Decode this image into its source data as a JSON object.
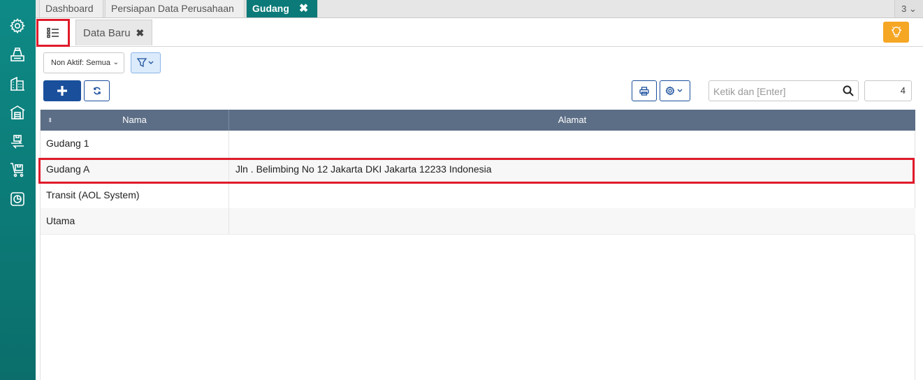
{
  "tabs": [
    {
      "label": "Dashboard"
    },
    {
      "label": "Persiapan Data Perusahaan"
    },
    {
      "label": "Gudang",
      "close": "✖"
    }
  ],
  "tab_count": "3 ⌄",
  "subtab": {
    "label": "Data Baru",
    "close": "✖"
  },
  "filter": {
    "value": "Non Aktif: Semua",
    "chevron": "⌄"
  },
  "search": {
    "placeholder": "Ketik dan [Enter]"
  },
  "record_count": "4",
  "table": {
    "columns": [
      "Nama",
      "Alamat"
    ],
    "rows": [
      {
        "nama": "Gudang 1",
        "alamat": ""
      },
      {
        "nama": "Gudang A",
        "alamat": "Jln . Belimbing No 12 Jakarta DKI Jakarta 12233 Indonesia"
      },
      {
        "nama": "Transit (AOL System)",
        "alamat": ""
      },
      {
        "nama": "Utama",
        "alamat": ""
      }
    ]
  },
  "sort_glyph": "⬍",
  "colors": {
    "sidebar": "#0b7a78",
    "header": "#5c6e86",
    "primary": "#1a4f9c",
    "highlight": "#e01b2b",
    "bulb": "#f5a623"
  }
}
